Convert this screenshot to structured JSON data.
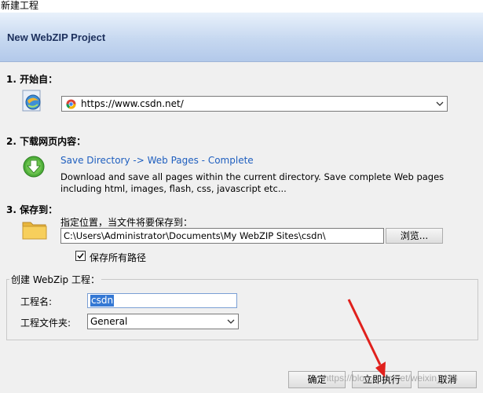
{
  "window": {
    "title": "新建工程"
  },
  "banner": {
    "title": "New WebZIP Project"
  },
  "section1": {
    "label": "1. 开始自：",
    "url": "https://www.csdn.net/"
  },
  "section2": {
    "label": "2. 下载网页内容：",
    "mode": "Save Directory -> Web Pages - Complete",
    "description": "Download and save all pages within the current directory. Save complete Web pages including html, images, flash, css, javascript etc..."
  },
  "section3": {
    "label": "3. 保存到：",
    "hint": "指定位置，当文件将要保存到：",
    "path": "C:\\Users\\Administrator\\Documents\\My WebZIP Sites\\csdn\\",
    "browse_label": "浏览...",
    "save_paths_label": "保存所有路径"
  },
  "create_group": {
    "title": "创建 WebZip 工程：",
    "name_label": "工程名:",
    "name_value": "csdn",
    "folder_label": "工程文件夹:",
    "folder_value": "General"
  },
  "buttons": {
    "ok": "确定",
    "run": "立即执行",
    "cancel": "取消"
  },
  "watermark": "https://blog.csdn.net/weixin_418",
  "colors": {
    "accent": "#3478d4",
    "link": "#1f5fbf",
    "arrow": "#e0201c"
  },
  "icons": [
    "ie-globe-icon",
    "chrome-icon",
    "download-arrow-icon",
    "folder-icon",
    "checkmark-icon",
    "chevron-down-icon"
  ]
}
